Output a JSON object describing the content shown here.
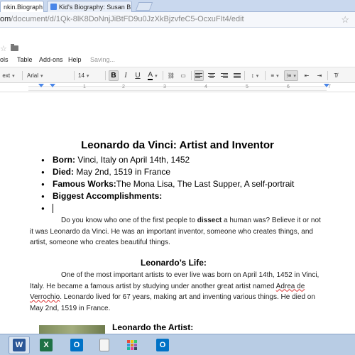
{
  "browser": {
    "tabs": [
      {
        "label": "nkin.Biograph…",
        "active": true
      },
      {
        "label": "Kid's Biography: Susan B…",
        "active": false
      }
    ],
    "url_host": "om",
    "url_path": "/document/d/1Qk-8lK8DoNnjJiBtFD9u0JzXkBjzvfeC5-OcxuFIt4/edit"
  },
  "menu": {
    "items": [
      "ols",
      "Table",
      "Add-ons",
      "Help"
    ],
    "status": "Saving..."
  },
  "toolbar": {
    "style": "ext",
    "font": "Arial",
    "size": "14",
    "bold": "B",
    "italic": "I",
    "underline": "U",
    "text_color": "A"
  },
  "ruler": {
    "ticks": [
      "1",
      "2",
      "3",
      "4",
      "5",
      "6",
      "7"
    ]
  },
  "document": {
    "title": "Leonardo da Vinci: Artist and Inventor",
    "bullets": [
      {
        "label": "Born:",
        "text": " Vinci, Italy on April 14th, 1452"
      },
      {
        "label": "Died:",
        "text": " May 2nd, 1519 in France"
      },
      {
        "label": "Famous Works:",
        "text": "The Mona Lisa, The Last Supper, A self-portrait"
      },
      {
        "label": "Biggest Accomplishments:",
        "text": ""
      },
      {
        "label": "",
        "text": ""
      }
    ],
    "intro_pre": "Do you know who one of the first people to ",
    "intro_bold": "dissect",
    "intro_post": " a human was? Believe it or not it was Leonardo da Vinci. He was an important inventor, someone who creates things, and artist, someone who creates beautiful things.",
    "heading_life": "Leonardo’s Life:",
    "life_pre": "One of the most important artists to ever live was born on April 14th, 1452 in Vinci, Italy. He became a famous artist by studying under another great artist named ",
    "life_name": "Adrea de Verrochio",
    "life_post": ". Leonardo lived for 67 years, making art and inventing various things. He died on May 2nd, 1519 in France.",
    "heading_artist": "Leonardo the Artist:"
  },
  "taskbar": {
    "apps": [
      {
        "icon": "word-icon",
        "letter": "W",
        "color": "#2b5797"
      },
      {
        "icon": "excel-icon",
        "letter": "X",
        "color": "#1e7145"
      },
      {
        "icon": "outlook-icon",
        "letter": "O",
        "color": "#0072c6"
      },
      {
        "icon": "document-icon",
        "letter": "",
        "color": "#f0f0f0"
      },
      {
        "icon": "apps-grid-icon",
        "letter": "",
        "color": ""
      },
      {
        "icon": "outlook-icon",
        "letter": "O",
        "color": "#0072c6"
      }
    ]
  }
}
